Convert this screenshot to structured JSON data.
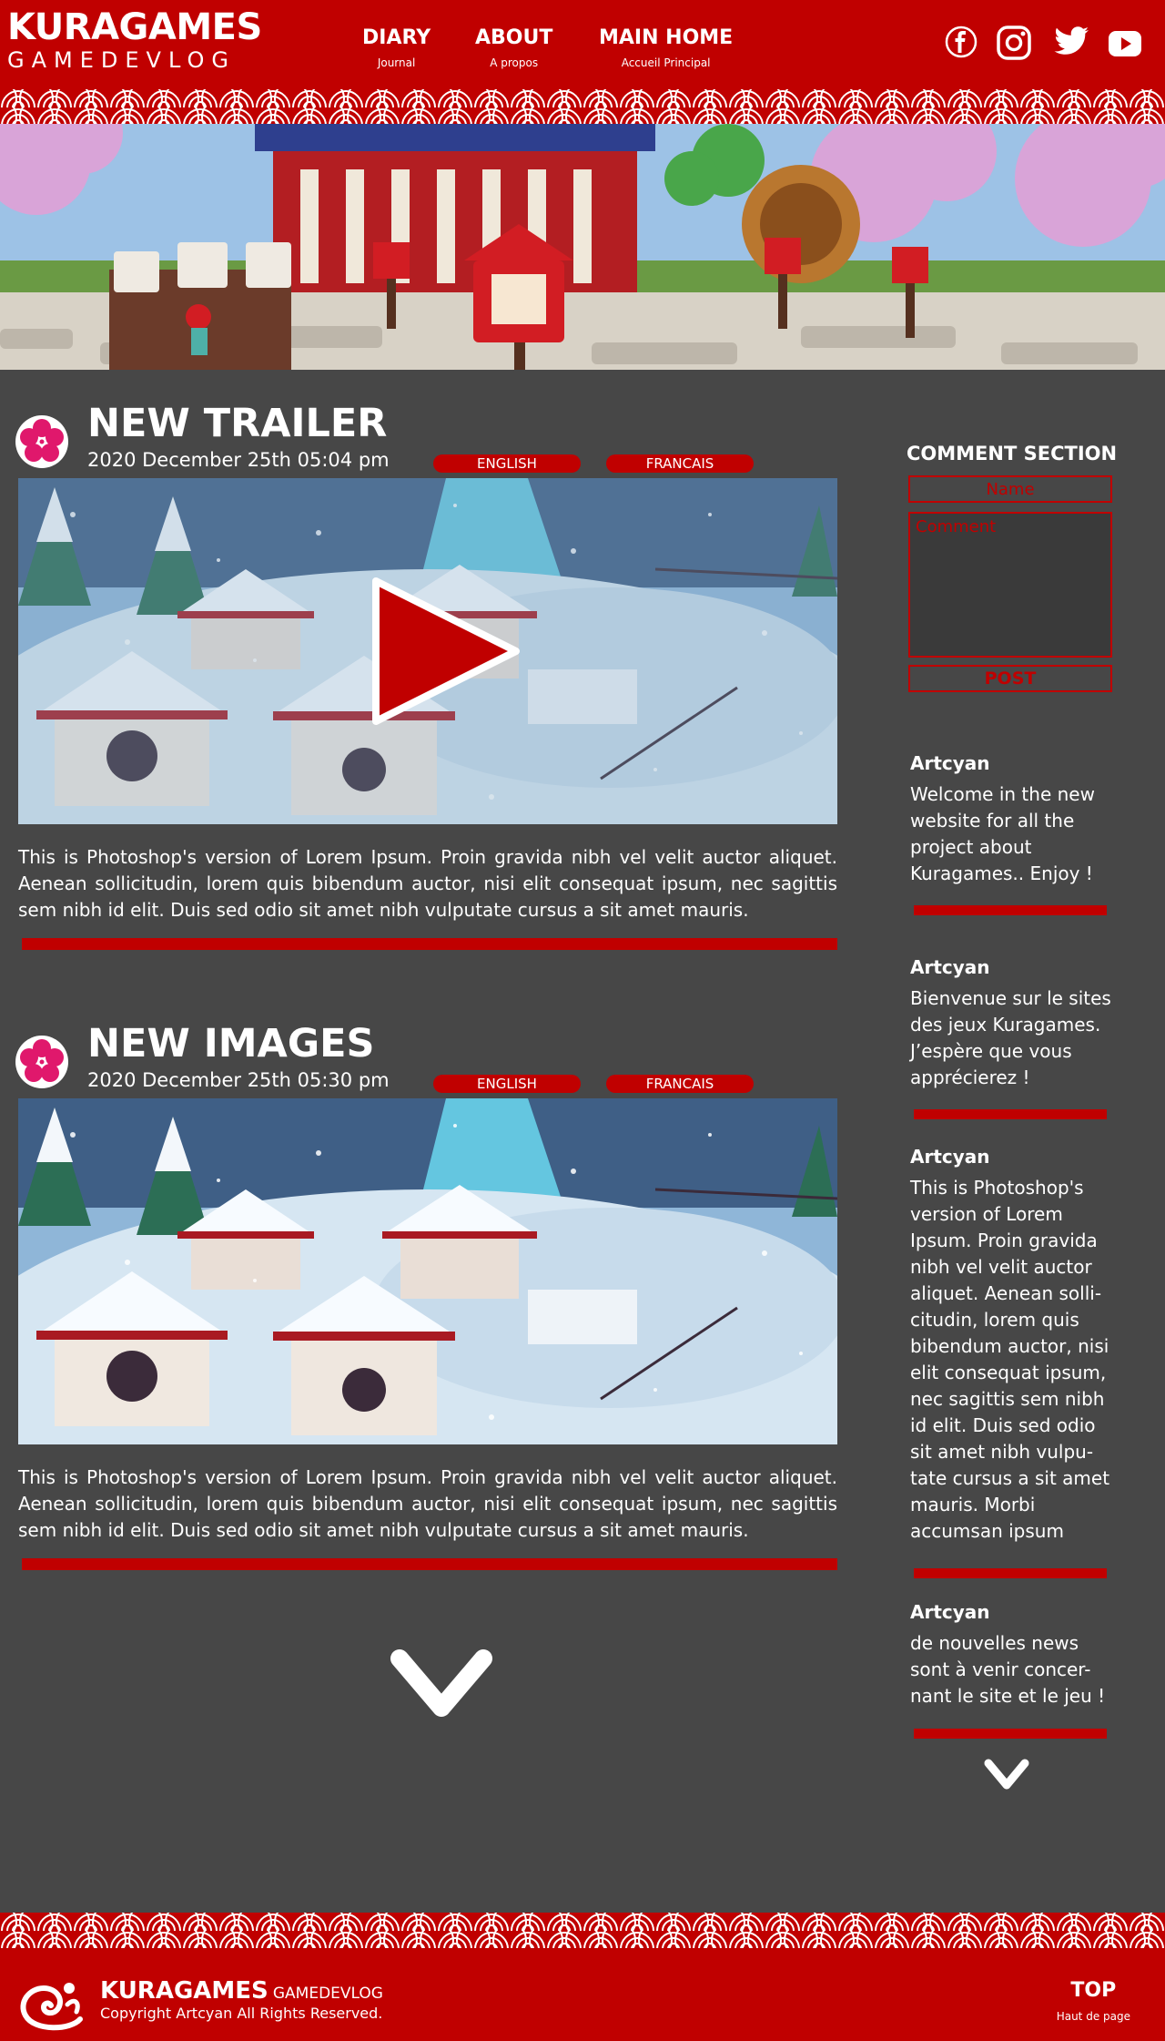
{
  "header": {
    "logo_main": "KURAGAMES",
    "logo_sub": "GAMEDEVLOG",
    "nav": [
      {
        "label": "DIARY",
        "sub": "Journal"
      },
      {
        "label": "ABOUT",
        "sub": "A propos"
      },
      {
        "label": "MAIN HOME",
        "sub": "Accueil Principal"
      }
    ],
    "social_icons": [
      "facebook-icon",
      "instagram-icon",
      "twitter-icon",
      "youtube-icon"
    ]
  },
  "posts": [
    {
      "title": "NEW TRAILER",
      "date": "2020 December 25th 05:04 pm",
      "lang_en": "ENGLISH",
      "lang_fr": "FRANCAIS",
      "text": "This is Photoshop's version  of Lorem Ipsum. Proin gravida nibh vel velit auctor aliquet. Aenean sollicitudin, lorem quis bibendum auctor, nisi elit consequat ipsum, nec sagittis sem nibh id elit. Duis sed odio sit amet nibh vulputate cursus a sit amet mauris."
    },
    {
      "title": "NEW IMAGES",
      "date": "2020 December 25th 05:30 pm",
      "lang_en": "ENGLISH",
      "lang_fr": "FRANCAIS",
      "text": "This is Photoshop's version  of Lorem Ipsum. Proin gravida nibh vel velit auctor aliquet. Aenean sollicitudin, lorem quis bibendum auctor, nisi elit consequat ipsum, nec sagittis sem nibh id elit. Duis sed odio sit amet nibh vulputate cursus a sit amet mauris."
    }
  ],
  "sidebar": {
    "title": "COMMENT SECTION",
    "name_placeholder": "Name",
    "comment_placeholder": "Comment",
    "post_label": "POST",
    "comments": [
      {
        "author": "Artcyan",
        "text": "Welcome in the new website for all the project about Kuragames.. Enjoy !"
      },
      {
        "author": "Artcyan",
        "text": "Bienvenue sur le sites des jeux Kuragames. J’espère que vous apprécierez !"
      },
      {
        "author": "Artcyan",
        "text": "This is Photoshop's version  of Lorem Ipsum. Proin gravida nibh vel velit auctor aliquet. Aenean solli-citudin, lorem quis bibendum auctor, nisi elit consequat ipsum, nec sagittis sem nibh id elit. Duis sed odio sit amet nibh vulpu-tate cursus a sit amet mauris. Morbi accumsan ipsum"
      },
      {
        "author": "Artcyan",
        "text": "de nouvelles news sont à venir concer-nant le site et le jeu !"
      }
    ]
  },
  "footer": {
    "brand": "KURAGAMES",
    "brand_sub": "GAMEDEVLOG",
    "copyright": "Copyright Artcyan All Rights Reserved.",
    "top_label": "TOP",
    "top_sub": "Haut de page"
  },
  "colors": {
    "brand_red": "#c00000",
    "background": "#474747",
    "text": "#ffffff"
  }
}
